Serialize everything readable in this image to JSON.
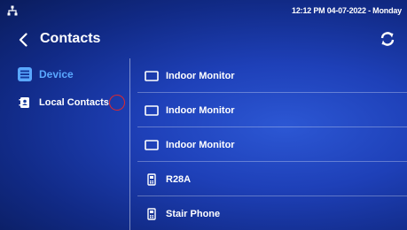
{
  "status": {
    "datetime": "12:12 PM 04-07-2022 - Monday"
  },
  "header": {
    "title": "Contacts"
  },
  "sidebar": {
    "items": [
      {
        "label": "Device",
        "icon": "device-list-icon",
        "active_color": "#5aa8ff"
      },
      {
        "label": "Local Contacts",
        "icon": "contacts-book-icon"
      }
    ]
  },
  "devices": [
    {
      "label": "Indoor Monitor",
      "icon": "monitor-icon"
    },
    {
      "label": "Indoor Monitor",
      "icon": "monitor-icon"
    },
    {
      "label": "Indoor Monitor",
      "icon": "monitor-icon"
    },
    {
      "label": "R28A",
      "icon": "door-phone-icon"
    },
    {
      "label": "Stair Phone",
      "icon": "door-phone-icon"
    }
  ],
  "colors": {
    "accent": "#5aa8ff",
    "annotation": "#e0282c"
  }
}
